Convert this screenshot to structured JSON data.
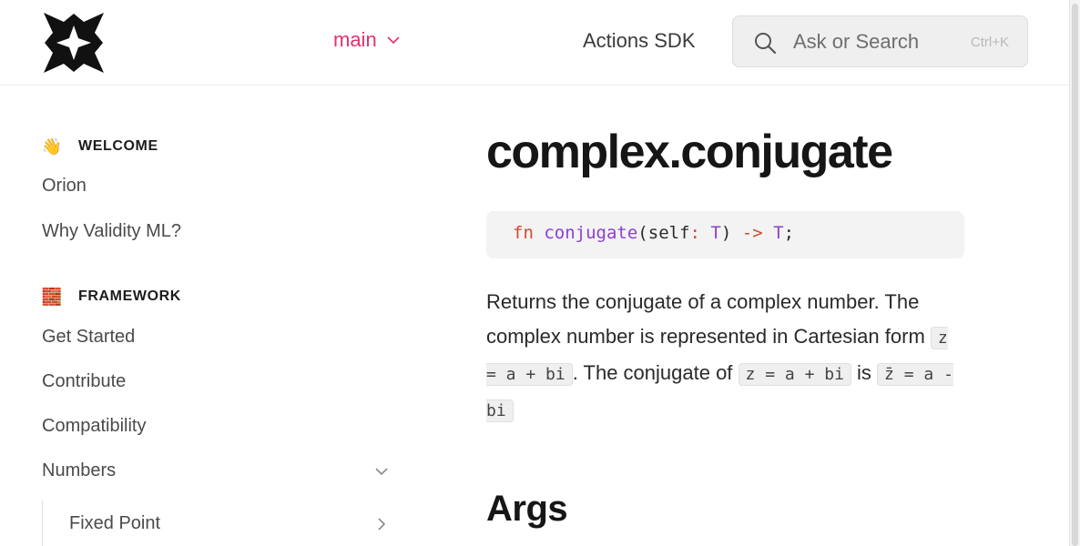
{
  "header": {
    "version_label": "main",
    "nav_link": "Actions SDK",
    "search_placeholder": "Ask or Search",
    "search_shortcut": "Ctrl+K"
  },
  "sidebar": {
    "sections": [
      {
        "emoji": "👋",
        "title": "WELCOME",
        "items": [
          "Orion",
          "Why Validity ML?"
        ]
      },
      {
        "emoji": "🧱",
        "title": "FRAMEWORK",
        "items": [
          "Get Started",
          "Contribute",
          "Compatibility",
          "Numbers"
        ]
      }
    ],
    "sub_items": [
      "Fixed Point"
    ]
  },
  "main": {
    "title": "complex.conjugate",
    "signature": {
      "kw": "fn",
      "name": "conjugate",
      "open": "(",
      "param": "self",
      "colon": ":",
      "param_type": "T",
      "close": ")",
      "arrow": "->",
      "ret_type": "T",
      "semi": ";"
    },
    "description": {
      "part1": "Returns the conjugate of a complex number. The complex number is represented in Cartesian form ",
      "code1": "z = a + bi",
      "part2": ". The conjugate of ",
      "code2": "z = a + bi",
      "part3": " is ",
      "code3": "z̄ = a - bi"
    },
    "section_heading": "Args"
  },
  "colors": {
    "accent": "#e6306b",
    "keyword": "#d2492a",
    "function": "#8c40d0"
  }
}
